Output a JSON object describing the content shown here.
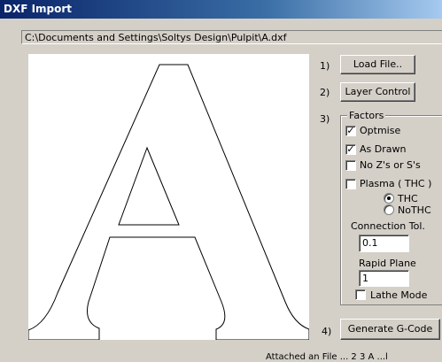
{
  "window": {
    "title": "DXF Import"
  },
  "file_path": "C:\\Documents and Settings\\Soltys Design\\Pulpit\\A.dxf",
  "steps": {
    "step1": "1)",
    "step2": "2)",
    "step3": "3)",
    "step4": "4)"
  },
  "buttons": {
    "load_file": "Load File..",
    "layer_control": "Layer Control",
    "generate_gcode": "Generate G-Code"
  },
  "factors": {
    "label": "Factors",
    "optimise": {
      "label": "Optmise",
      "checked": true
    },
    "as_drawn": {
      "label": "As Drawn",
      "checked": true
    },
    "no_zs": {
      "label": "No Z's or S's",
      "checked": false
    },
    "plasma": {
      "label": "Plasma ( THC )",
      "checked": false
    },
    "thc": {
      "label": "THC",
      "selected": true
    },
    "nothc": {
      "label": "NoTHC",
      "selected": false
    },
    "connection_tol": {
      "label": "Connection Tol.",
      "value": "0.1"
    },
    "rapid_plane": {
      "label": "Rapid Plane",
      "value": "1"
    },
    "lathe_mode": {
      "label": "Lathe Mode",
      "checked": false
    }
  },
  "status_text": "Attached an File ... 2 3 A ...l"
}
